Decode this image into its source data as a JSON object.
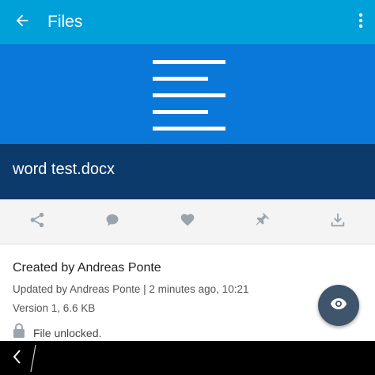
{
  "appbar": {
    "title": "Files",
    "back_icon": "arrow-left-icon",
    "menu_icon": "more-vertical-icon",
    "color": "#00a0d8"
  },
  "preview": {
    "icon": "document-lines-icon",
    "banner_color": "#0a78d8",
    "filename": "word test.docx",
    "filename_band_color": "#0b3a6b"
  },
  "actions": [
    {
      "name": "share",
      "icon": "share-icon"
    },
    {
      "name": "comment",
      "icon": "comment-icon"
    },
    {
      "name": "like",
      "icon": "heart-icon"
    },
    {
      "name": "pin",
      "icon": "pin-icon"
    },
    {
      "name": "download",
      "icon": "download-icon"
    }
  ],
  "details": {
    "created": "Created by Andreas Ponte",
    "updated": "Updated by Andreas Ponte | 2 minutes ago, 10:21",
    "version": "Version 1, 6.6 KB",
    "lock_status": "File unlocked."
  },
  "fab": {
    "icon": "eye-icon",
    "color": "#3e556b"
  },
  "navbar": {
    "back_icon": "nav-back-icon"
  }
}
